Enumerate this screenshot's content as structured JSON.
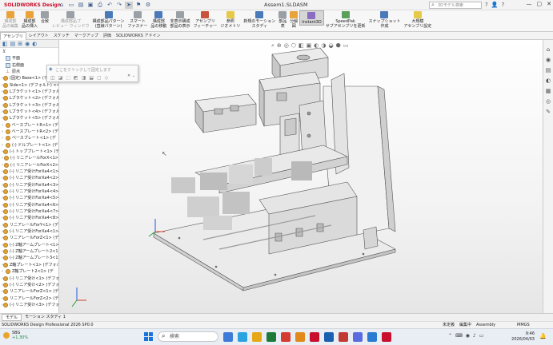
{
  "app": {
    "logo_text": "SOLIDWORKS Design",
    "document_title": "Assem1.SLDASM",
    "search_placeholder": "3Dモデル検索",
    "window_controls": [
      "—",
      "▢",
      "✕"
    ]
  },
  "quick_access": [
    {
      "icon": "home-icon",
      "glyph": "⌂"
    },
    {
      "icon": "new-icon",
      "glyph": "▭"
    },
    {
      "icon": "open-icon",
      "glyph": "▤"
    },
    {
      "icon": "save-icon",
      "glyph": "▣"
    },
    {
      "icon": "print-icon",
      "glyph": "⎙"
    },
    {
      "icon": "undo-icon",
      "glyph": "↶"
    },
    {
      "icon": "redo-icon",
      "glyph": "↷"
    },
    {
      "icon": "select-icon",
      "glyph": "➤"
    },
    {
      "icon": "rebuild-icon",
      "glyph": "⚑"
    },
    {
      "icon": "options-icon",
      "glyph": "⚙"
    }
  ],
  "title_icons": [
    "?",
    "👤",
    "?"
  ],
  "ribbon": [
    {
      "label": "構成部\n品の編集",
      "color": "o",
      "disabled": true,
      "name": "edit-component"
    },
    {
      "label": "構成部\n品の挿入",
      "color": "o",
      "disabled": false,
      "name": "insert-component"
    },
    {
      "label": "合致",
      "color": "g",
      "disabled": false,
      "name": "mate"
    },
    {
      "label": "構成部品プ\nレビュー ウィンドウ",
      "color": "g",
      "disabled": true,
      "name": "component-preview"
    },
    {
      "label": "構成部品パターン\n(直線パターン)",
      "color": "b",
      "disabled": false,
      "name": "linear-pattern"
    },
    {
      "label": "スマート\nファスナー",
      "color": "g",
      "disabled": false,
      "name": "smart-fasteners"
    },
    {
      "label": "構成部\n品の移動",
      "color": "b",
      "disabled": false,
      "name": "move-component"
    },
    {
      "label": "非表示構成\n部品の表示",
      "color": "g",
      "disabled": false,
      "name": "show-hidden"
    },
    {
      "label": "アセンブリ\nフィーチャー",
      "color": "r",
      "disabled": false,
      "name": "assembly-features"
    },
    {
      "label": "参照\nジオメトリ",
      "color": "y",
      "disabled": false,
      "name": "reference-geometry"
    },
    {
      "label": "新規のモーション\nスタディ",
      "color": "b",
      "disabled": false,
      "name": "new-motion-study"
    },
    {
      "label": "部品\n表",
      "color": "g",
      "disabled": false,
      "name": "bom"
    },
    {
      "label": "分解\n図",
      "color": "o",
      "disabled": false,
      "name": "exploded-view"
    },
    {
      "label": "Instant3D",
      "color": "p",
      "disabled": false,
      "name": "instant3d",
      "active": true
    },
    {
      "label": "SpeedPak\nサブアセンブリを更新",
      "color": "gr",
      "disabled": false,
      "name": "speedpak"
    },
    {
      "label": "スナップショット\n作成",
      "color": "b",
      "disabled": false,
      "name": "snapshot"
    },
    {
      "label": "大規模\nアセンブリ設定",
      "color": "y",
      "disabled": false,
      "name": "large-assembly"
    }
  ],
  "command_tabs": [
    {
      "label": "アセンブリ",
      "active": true
    },
    {
      "label": "レイアウト",
      "active": false
    },
    {
      "label": "スケッチ",
      "active": false
    },
    {
      "label": "マークアップ",
      "active": false
    },
    {
      "label": "評価",
      "active": false
    },
    {
      "label": "SOLIDWORKS アドイン",
      "active": false
    }
  ],
  "feature_manager": {
    "tab_icons": [
      "◧",
      "▤",
      "⊞",
      "◉",
      "◐"
    ],
    "filter_glyph": "⊻",
    "items": [
      {
        "label": "平面",
        "type": "plane",
        "exp": ""
      },
      {
        "label": "右側面",
        "type": "plane",
        "exp": ""
      },
      {
        "label": "原点",
        "type": "origin",
        "exp": ""
      },
      {
        "label": "(固定) Base<1> (デフォルト",
        "type": "part",
        "exp": "›"
      },
      {
        "label": "Side<1> (デフォルト) <<デ",
        "type": "part",
        "exp": "›"
      },
      {
        "label": "Lブラケット<1> (デフォルト)",
        "type": "part",
        "exp": "›"
      },
      {
        "label": "Lブラケット<2> (デフォルト)",
        "type": "part",
        "exp": "›"
      },
      {
        "label": "Lブラケット<3> (デフォルト)",
        "type": "part",
        "exp": "›"
      },
      {
        "label": "Lブラケット<4> (デフォルト)",
        "type": "part",
        "exp": "›"
      },
      {
        "label": "Lブラケット<5> (デフォルト)",
        "type": "part",
        "exp": "›"
      },
      {
        "label": "ベースプレートR<1> (デ",
        "type": "part",
        "exp": "›"
      },
      {
        "label": "ベースプレートR<2> (デ",
        "type": "part",
        "exp": "›"
      },
      {
        "label": "ベースプレート<1> (デ",
        "type": "part",
        "exp": "›"
      },
      {
        "label": "(-) ドルプレート<1> (デ",
        "type": "part",
        "exp": "›"
      },
      {
        "label": "(-) トッププレート<1> (デ",
        "type": "part",
        "exp": "›"
      },
      {
        "label": "(-) リニアレールForX<1>",
        "type": "part",
        "exp": "›"
      },
      {
        "label": "(-) リニアレールForX<2>",
        "type": "part",
        "exp": "›"
      },
      {
        "label": "(-) リニア受けForXa4<1>",
        "type": "part",
        "exp": "›"
      },
      {
        "label": "(-) リニア受けForXa4<2>",
        "type": "part",
        "exp": "›"
      },
      {
        "label": "(-) リニア受けForXa4<3>",
        "type": "part",
        "exp": "›"
      },
      {
        "label": "(-) リニア受けForXa4<4>",
        "type": "part",
        "exp": "›"
      },
      {
        "label": "(-) リニア受けForXa4<5>",
        "type": "part",
        "exp": "›"
      },
      {
        "label": "(-) リニア受けForXa4<6>",
        "type": "part",
        "exp": "›"
      },
      {
        "label": "(-) リニア受けForXa4<7>",
        "type": "part",
        "exp": "›"
      },
      {
        "label": "(-) リニア受けForXa4<8>",
        "type": "part",
        "exp": "›"
      },
      {
        "label": "リニアレールForY<1> (デ",
        "type": "part",
        "exp": "›"
      },
      {
        "label": "(-) リニア受けForXa4<1>",
        "type": "part",
        "exp": "›"
      },
      {
        "label": "リニアレールForZ<1> (デ",
        "type": "part",
        "exp": "›"
      },
      {
        "label": "(-) Z軸アームプレート<1>",
        "type": "part",
        "exp": "›"
      },
      {
        "label": "(-) Z軸アームプレート2<1>",
        "type": "part",
        "exp": "›"
      },
      {
        "label": "(-) Z軸アームプレート3<1>",
        "type": "part",
        "exp": "›"
      },
      {
        "label": "Z軸プレート<1> (デフォルト)",
        "type": "part",
        "exp": "›"
      },
      {
        "label": "Z軸プレート2<1> (デ",
        "type": "part",
        "exp": "›"
      },
      {
        "label": "(-) リニア受け<1> (デフォ",
        "type": "part",
        "exp": "›"
      },
      {
        "label": "(-) リニア受け<2> (デフォ",
        "type": "part",
        "exp": "›"
      },
      {
        "label": "リニアレールForZ<1> (デ",
        "type": "part",
        "exp": "›"
      },
      {
        "label": "リニアレールForZ<2> (デ",
        "type": "part",
        "exp": "›"
      },
      {
        "label": "(-) リニア受け<3> (デフォ",
        "type": "part",
        "exp": "›"
      }
    ]
  },
  "context_popup": {
    "placeholder": "ここをクリックして固定します",
    "tools": [
      "◫",
      "◪",
      "⬚",
      "◩",
      "◨",
      "⬓",
      "▢",
      "◇"
    ],
    "close_glyph": "✕ ⌄"
  },
  "heads_up": [
    "⌕",
    "⊕",
    "◎",
    "⬡",
    "◧",
    "▣",
    "◐",
    "◑",
    "◒",
    "⬢",
    "▭"
  ],
  "taskpane_icons": [
    "⌂",
    "◉",
    "▤",
    "◐",
    "▦",
    "◎",
    "✎"
  ],
  "bottom_tabs": [
    {
      "label": "モデル",
      "active": true
    },
    {
      "label": "モーション スタディ 1",
      "active": false
    }
  ],
  "status": {
    "left": "SOLIDWORKS Design Professional 2026 SP0.0",
    "s1": "未定義",
    "s2": "編集中",
    "s3": "Assembly",
    "units": "MMGS"
  },
  "taskbar": {
    "weather_label": "SBG",
    "weather_value": "+1.30%",
    "search_label": "検索",
    "time": "9:46",
    "date": "2026/04/03",
    "apps": [
      "#3d7bd9",
      "#2aa3e0",
      "#e6a817",
      "#1f7a3a",
      "#d63b2f",
      "#e1891b",
      "#c8102e",
      "#1b5fb0",
      "#c23b32",
      "#5b6be0",
      "#2b7bd3",
      "#c8102e"
    ],
    "tray": [
      "⌃",
      "⌨",
      "◉",
      "♪",
      "▭"
    ]
  }
}
